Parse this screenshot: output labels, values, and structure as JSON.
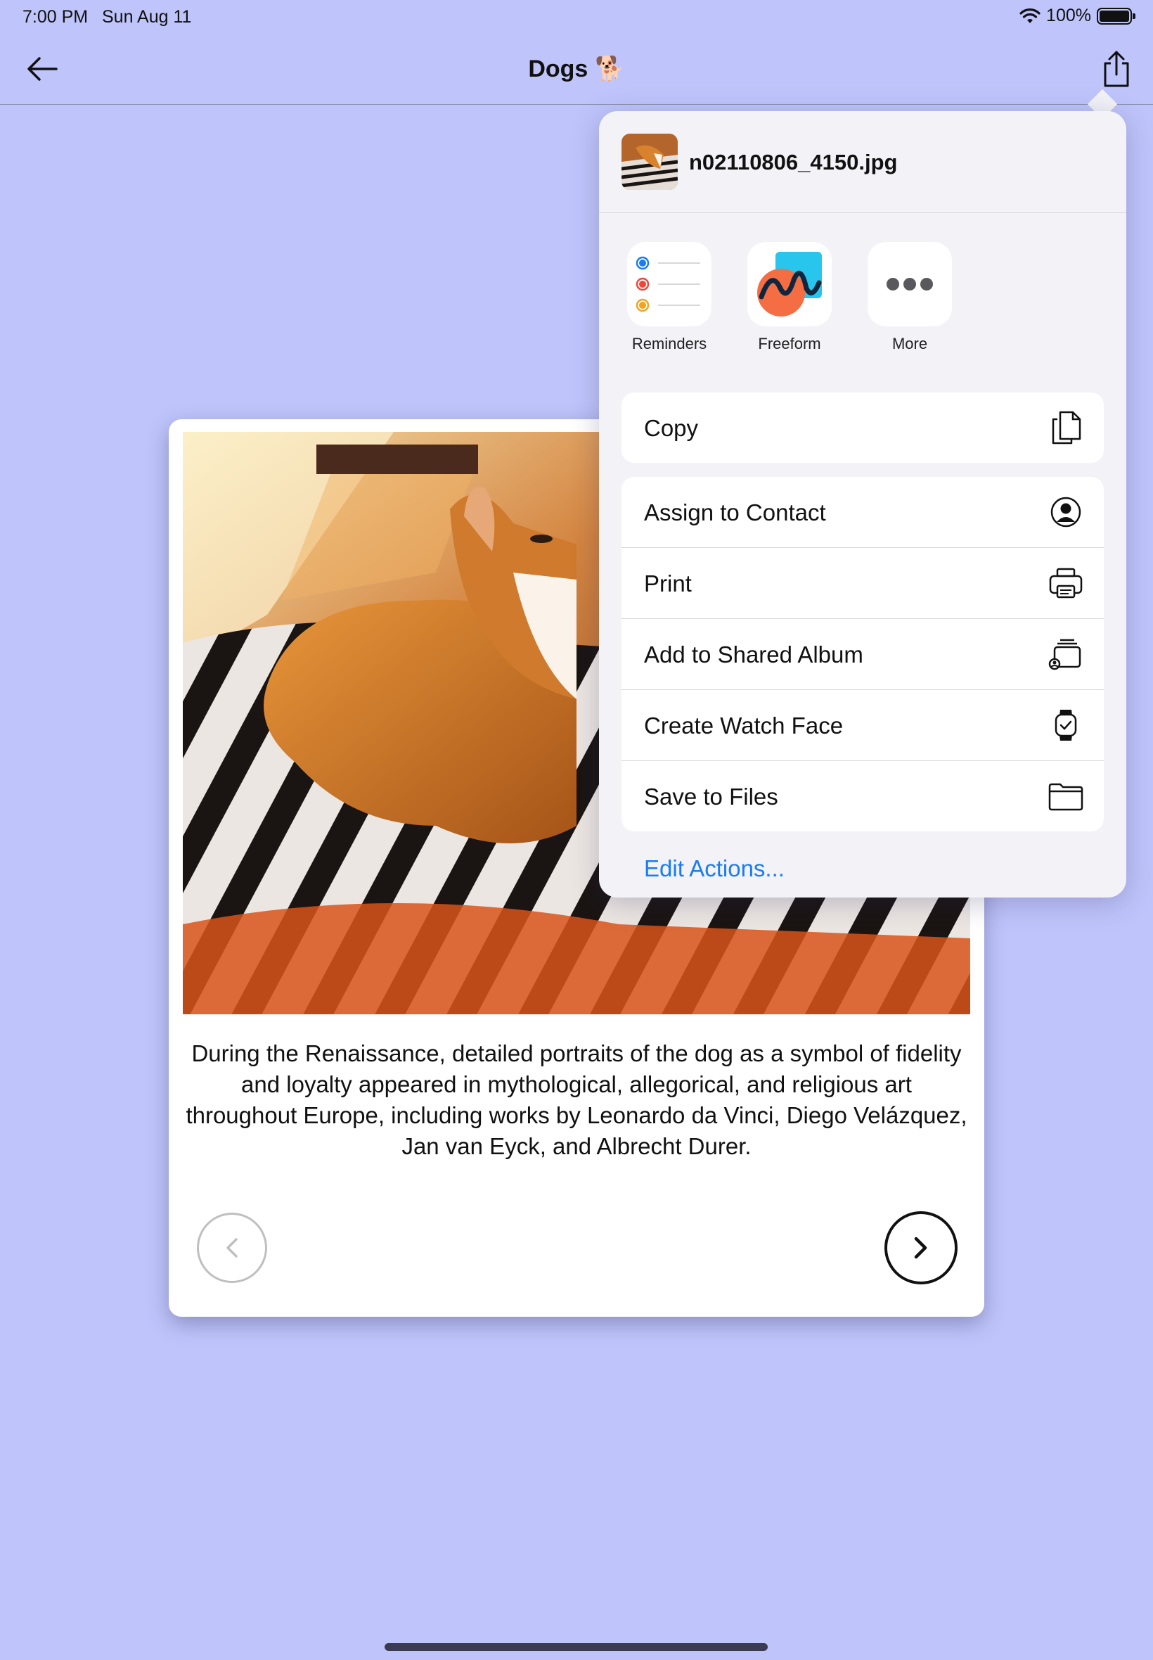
{
  "status_bar": {
    "time": "7:00 PM",
    "date": "Sun Aug 11",
    "battery": "100%"
  },
  "navbar": {
    "title": "Dogs",
    "title_emoji": "🐕"
  },
  "card": {
    "caption": "During the Renaissance, detailed portraits of the dog as a symbol of fidelity and loyalty appeared in mythological, allegorical, and religious art throughout Europe, including works by Leonardo da Vinci, Diego Velázquez, Jan van Eyck, and Albrecht Durer."
  },
  "share_sheet": {
    "filename": "n02110806_4150.jpg",
    "apps": [
      {
        "label": "Reminders",
        "icon": "reminders-icon"
      },
      {
        "label": "Freeform",
        "icon": "freeform-icon"
      },
      {
        "label": "More",
        "icon": "more-icon"
      }
    ],
    "copy_label": "Copy",
    "actions": [
      {
        "label": "Assign to Contact",
        "icon": "person-circle-icon"
      },
      {
        "label": "Print",
        "icon": "printer-icon"
      },
      {
        "label": "Add to Shared Album",
        "icon": "shared-album-icon"
      },
      {
        "label": "Create Watch Face",
        "icon": "watch-icon"
      },
      {
        "label": "Save to Files",
        "icon": "folder-icon"
      }
    ],
    "edit_actions": "Edit Actions..."
  },
  "colors": {
    "background": "#bfc5fb",
    "link": "#1a7cf4",
    "sheet": "#f2f2f7"
  }
}
